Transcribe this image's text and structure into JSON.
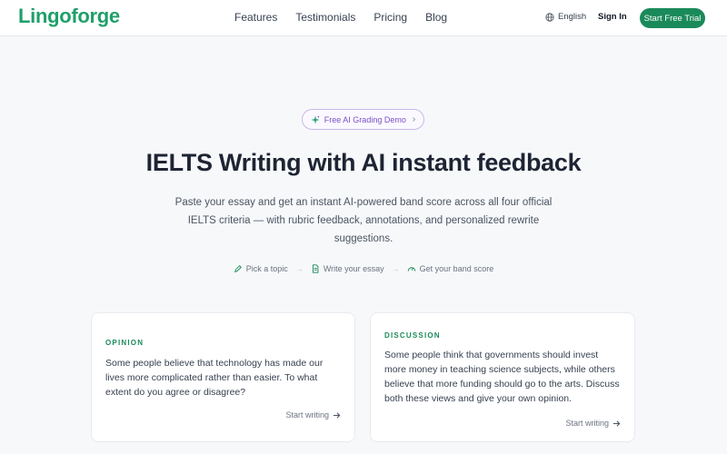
{
  "header": {
    "logo": "Lingoforge",
    "nav": [
      "Features",
      "Testimonials",
      "Pricing",
      "Blog"
    ],
    "language": "English",
    "sign_in": "Sign In",
    "cta": "Start Free Trial"
  },
  "hero": {
    "pill": "Free AI Grading Demo",
    "title": "IELTS Writing with AI instant feedback",
    "subtitle": "Paste your essay and get an instant AI-powered band score across all four official IELTS criteria — with rubric feedback, annotations, and personalized rewrite suggestions.",
    "steps": [
      "Pick a topic",
      "Write your essay",
      "Get your band score"
    ]
  },
  "cards": [
    {
      "tag": "OPINION",
      "prompt": "Some people believe that technology has made our lives more complicated rather than easier. To what extent do you agree or disagree?",
      "action": "Start writing"
    },
    {
      "tag": "DISCUSSION",
      "prompt": "Some people think that governments should invest more money in teaching science subjects, while others believe that more funding should go to the arts. Discuss both these views and give your own opinion.",
      "action": "Start writing"
    }
  ],
  "colors": {
    "brand": "#1fa06a",
    "cta": "#1a8a5a",
    "accent_purple": "#7b4fc5"
  },
  "icons": {
    "language": "globe-icon",
    "pill": "sparkle-icon",
    "step1": "pencil-leaf-icon",
    "step2": "document-icon",
    "step3": "gauge-icon",
    "action": "arrow-right-icon"
  }
}
